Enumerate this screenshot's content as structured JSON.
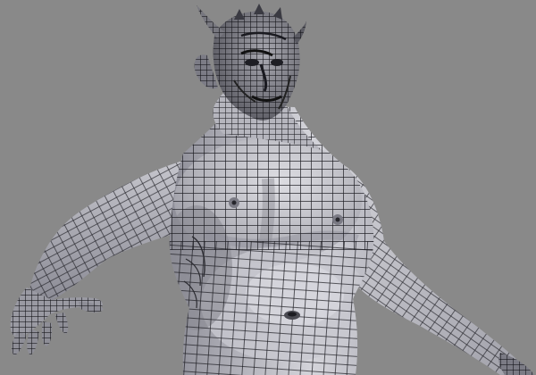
{
  "scene": {
    "subject": "wireframe-creature-bust",
    "background_color": "#898989",
    "surface_color": "#c3c3c9",
    "surface_shadow": "#7e7e88",
    "surface_highlight": "#e0e0e6",
    "wire_color": "#1c1c22"
  }
}
